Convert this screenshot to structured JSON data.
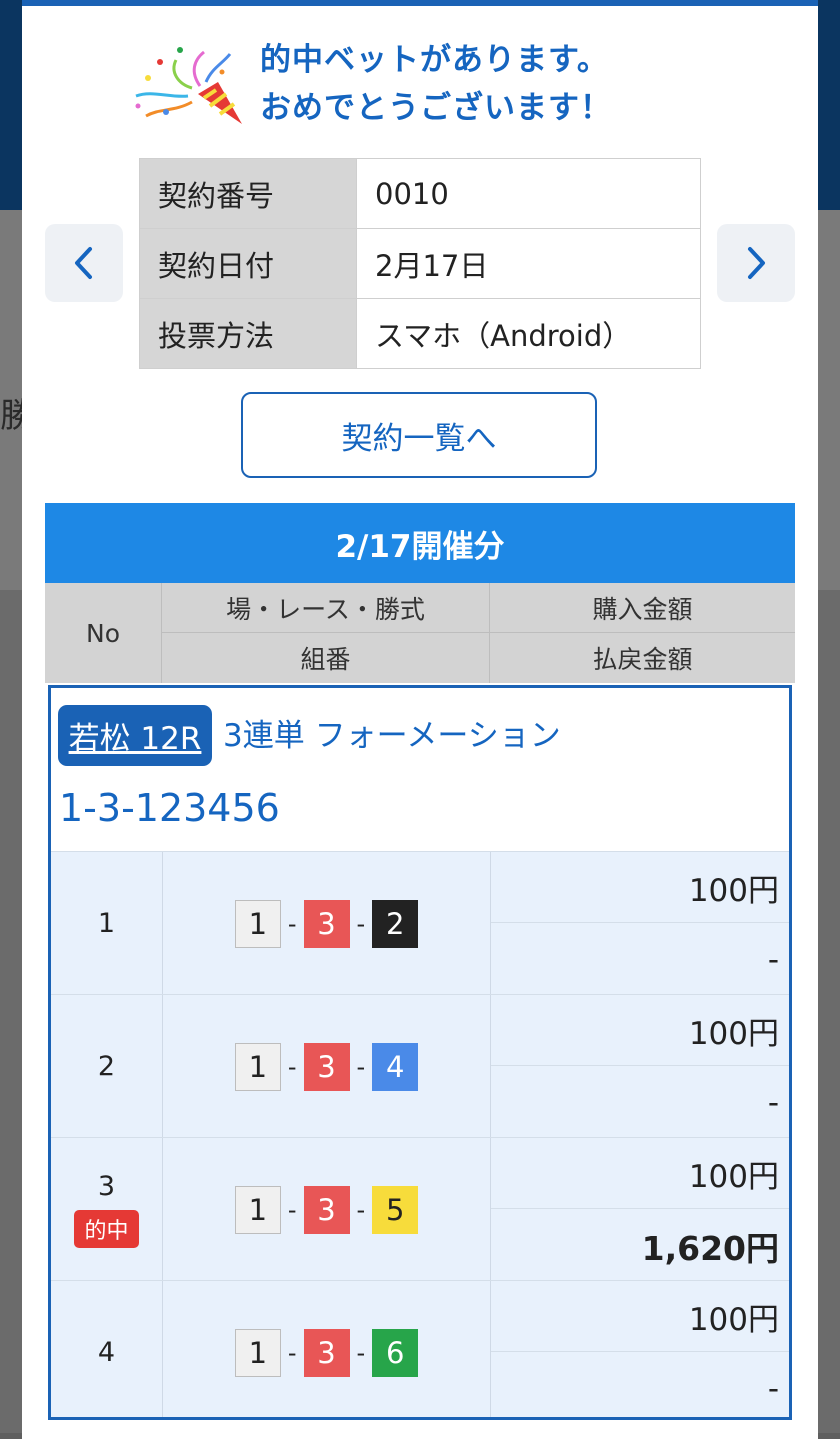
{
  "background": {
    "partial_text": "勝"
  },
  "congrats": {
    "line1": "的中ベットがあります。",
    "line2": "おめでとうございます！",
    "icon": "party-popper-icon"
  },
  "nav": {
    "prev_icon": "chevron-left-icon",
    "next_icon": "chevron-right-icon"
  },
  "contract": {
    "rows": [
      {
        "label": "契約番号",
        "value": "0010"
      },
      {
        "label": "契約日付",
        "value": "2月17日"
      },
      {
        "label": "投票方法",
        "value": "スマホ（Android）"
      }
    ]
  },
  "list_button": "契約一覧へ",
  "session": {
    "title": "2/17開催分",
    "headers": {
      "no": "No",
      "race": "場・レース・勝式",
      "buy": "購入金額",
      "combo": "組番",
      "payout": "払戻金額"
    }
  },
  "bet": {
    "race": "若松 12R",
    "type": "3連単 フォーメーション",
    "combination": "1-3-123456",
    "hit_label": "的中",
    "separator": "-",
    "rows": [
      {
        "no": "1",
        "boats": [
          "1",
          "3",
          "2"
        ],
        "purchase": "100円",
        "payout": "-",
        "hit": false
      },
      {
        "no": "2",
        "boats": [
          "1",
          "3",
          "4"
        ],
        "purchase": "100円",
        "payout": "-",
        "hit": false
      },
      {
        "no": "3",
        "boats": [
          "1",
          "3",
          "5"
        ],
        "purchase": "100円",
        "payout": "1,620円",
        "hit": true
      },
      {
        "no": "4",
        "boats": [
          "1",
          "3",
          "6"
        ],
        "purchase": "100円",
        "payout": "-",
        "hit": false
      }
    ]
  },
  "boat_colors": {
    "1": {
      "bg": "#f0f0f0",
      "fg": "#222222",
      "border": "#bdbdbd"
    },
    "2": {
      "bg": "#222222",
      "fg": "#ffffff",
      "border": "#222222"
    },
    "3": {
      "bg": "#e85656",
      "fg": "#ffffff",
      "border": "#e85656"
    },
    "4": {
      "bg": "#4a8ae8",
      "fg": "#ffffff",
      "border": "#4a8ae8"
    },
    "5": {
      "bg": "#f7dc3b",
      "fg": "#222222",
      "border": "#f7dc3b"
    },
    "6": {
      "bg": "#27a54a",
      "fg": "#ffffff",
      "border": "#27a54a"
    }
  },
  "colors": {
    "accent": "#1a62b5",
    "header_blue": "#1e88e5",
    "hit_red": "#e53935"
  }
}
